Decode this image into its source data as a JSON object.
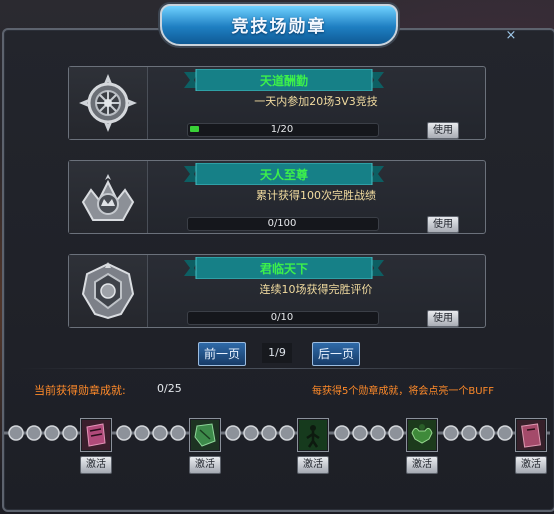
{
  "window": {
    "title": "竞技场勋章",
    "close_label": "×"
  },
  "achievements": [
    {
      "name": "天道酬勤",
      "desc": "一天内参加20场3V3竞技",
      "progress_text": "1/20",
      "progress_fraction": 0.05,
      "use_label": "使用",
      "icon": "wheel-medal-icon"
    },
    {
      "name": "天人至尊",
      "desc": "累计获得100次完胜战绩",
      "progress_text": "0/100",
      "progress_fraction": 0,
      "use_label": "使用",
      "icon": "crown-medal-icon"
    },
    {
      "name": "君临天下",
      "desc": "连续10场获得完胜评价",
      "progress_text": "0/10",
      "progress_fraction": 0,
      "use_label": "使用",
      "icon": "crest-medal-icon"
    }
  ],
  "pagination": {
    "prev_label": "前一页",
    "page_text": "1/9",
    "next_label": "后一页"
  },
  "status": {
    "label": "当前获得勋章成就:",
    "value": "0/25",
    "note": "每获得5个勋章成就，将会点亮一个BUFF"
  },
  "buffs": [
    {
      "activate_label": "激活",
      "icon": "scroll-buff-icon",
      "color": "#b04a7a"
    },
    {
      "activate_label": "激活",
      "icon": "stone-buff-icon",
      "color": "#3d8a4a"
    },
    {
      "activate_label": "激活",
      "icon": "figure-buff-icon",
      "color": "#2f7a3a"
    },
    {
      "activate_label": "激活",
      "icon": "muscle-buff-icon",
      "color": "#3f8a3a"
    },
    {
      "activate_label": "激活",
      "icon": "book-buff-icon",
      "color": "#a44a6a"
    }
  ],
  "colors": {
    "accent_green": "#3cf04b",
    "accent_orange": "#ff8a2a",
    "title_blue": "#1e7fc2"
  }
}
